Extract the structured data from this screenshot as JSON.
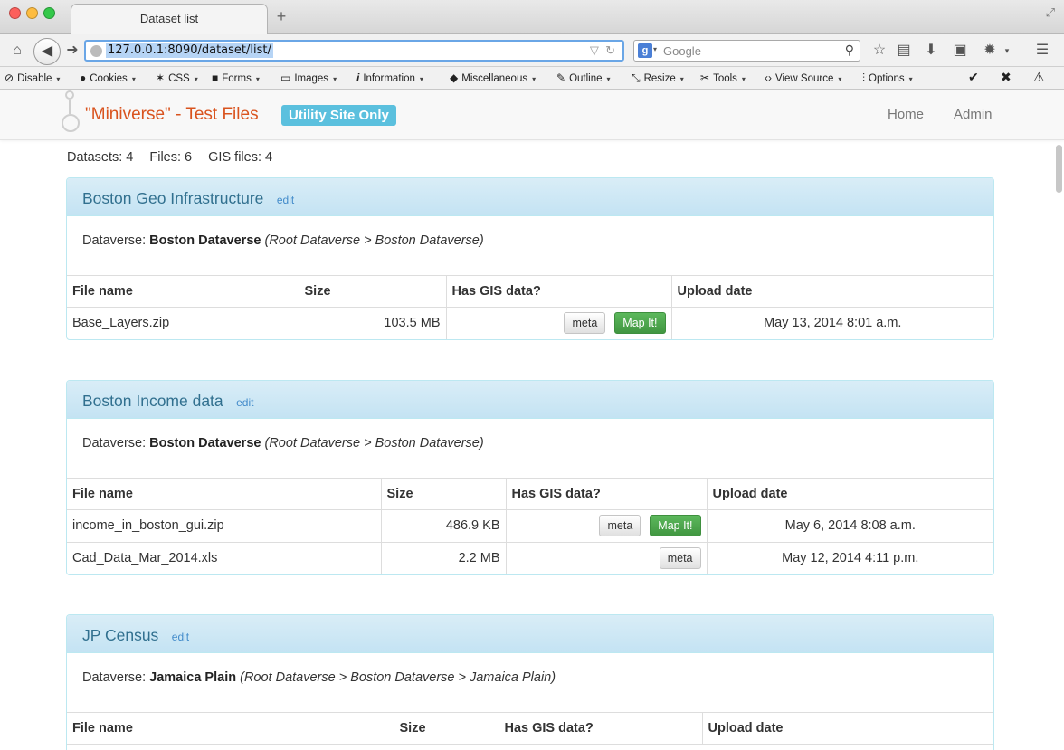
{
  "browser": {
    "tab_title": "Dataset list",
    "new_tab": "+",
    "url": "127.0.0.1:8090/dataset/list/",
    "search_engine_letter": "g",
    "search_placeholder": "Google"
  },
  "devbar": {
    "items": [
      {
        "label": "Disable",
        "icon": "disable-icon"
      },
      {
        "label": "Cookies",
        "icon": "cookies-icon"
      },
      {
        "label": "CSS",
        "icon": "css-icon"
      },
      {
        "label": "Forms",
        "icon": "forms-icon"
      },
      {
        "label": "Images",
        "icon": "images-icon"
      },
      {
        "label": "Information",
        "icon": "information-icon"
      },
      {
        "label": "Miscellaneous",
        "icon": "miscellaneous-icon"
      },
      {
        "label": "Outline",
        "icon": "outline-icon"
      },
      {
        "label": "Resize",
        "icon": "resize-icon"
      },
      {
        "label": "Tools",
        "icon": "tools-icon"
      },
      {
        "label": "View Source",
        "icon": "view-source-icon"
      },
      {
        "label": "Options",
        "icon": "options-icon"
      }
    ]
  },
  "site": {
    "brand": "\"Miniverse\" - Test Files",
    "badge": "Utility Site Only",
    "nav": {
      "home": "Home",
      "admin": "Admin"
    },
    "brand_color": "#d9531e",
    "accent_color": "#5bc0de"
  },
  "counts": {
    "datasets": "Datasets: 4",
    "files": "Files: 6",
    "gis": "GIS files: 4"
  },
  "datasets": [
    {
      "title": "Boston Geo Infrastructure",
      "edit": "edit",
      "dataverse_label": "Dataverse: ",
      "dataverse_name": "Boston Dataverse",
      "path": "(Root Dataverse > Boston Dataverse)",
      "headers": {
        "name": "File name",
        "size": "Size",
        "gis": "Has GIS data?",
        "date": "Upload date"
      },
      "files": [
        {
          "name": "Base_Layers.zip",
          "size": "103.5 MB",
          "meta": "meta",
          "map": "Map It!",
          "date": "May 13, 2014 8:01 a.m."
        }
      ]
    },
    {
      "title": "Boston Income data",
      "edit": "edit",
      "dataverse_label": "Dataverse: ",
      "dataverse_name": "Boston Dataverse",
      "path": "(Root Dataverse > Boston Dataverse)",
      "headers": {
        "name": "File name",
        "size": "Size",
        "gis": "Has GIS data?",
        "date": "Upload date"
      },
      "files": [
        {
          "name": "income_in_boston_gui.zip",
          "size": "486.9 KB",
          "meta": "meta",
          "map": "Map It!",
          "date": "May 6, 2014 8:08 a.m."
        },
        {
          "name": "Cad_Data_Mar_2014.xls",
          "size": "2.2 MB",
          "meta": "meta",
          "date": "May 12, 2014 4:11 p.m."
        }
      ]
    },
    {
      "title": "JP Census",
      "edit": "edit",
      "dataverse_label": "Dataverse: ",
      "dataverse_name": "Jamaica Plain",
      "path": "(Root Dataverse > Boston Dataverse > Jamaica Plain)",
      "headers": {
        "name": "File name",
        "size": "Size",
        "gis": "Has GIS data?",
        "date": "Upload date"
      },
      "files": []
    }
  ]
}
